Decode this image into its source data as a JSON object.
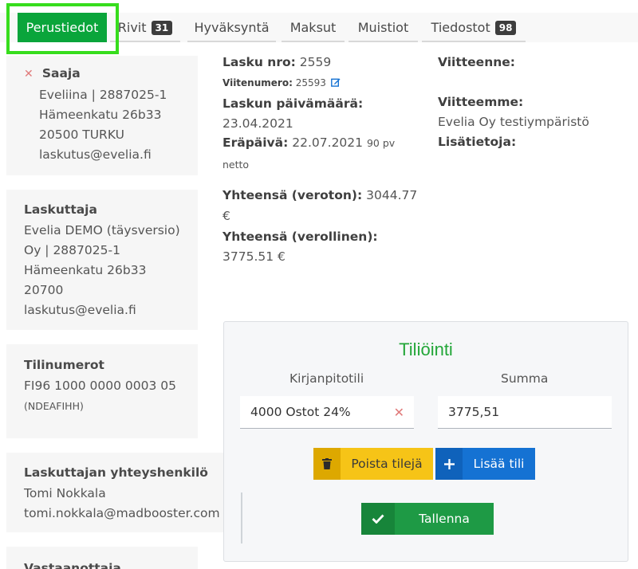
{
  "tabs": [
    {
      "label": "Perustiedot",
      "badge": null
    },
    {
      "label": "Rivit",
      "badge": "31"
    },
    {
      "label": "Hyväksyntä",
      "badge": null
    },
    {
      "label": "Maksut",
      "badge": null
    },
    {
      "label": "Muistiot",
      "badge": null
    },
    {
      "label": "Tiedostot",
      "badge": "98"
    }
  ],
  "recipient": {
    "title": "Saaja",
    "remove_symbol": "✕",
    "lines": [
      "Eveliina | 2887025-1",
      "Hämeenkatu 26b33",
      "20500 TURKU",
      "laskutus@evelia.fi"
    ]
  },
  "biller": {
    "title": "Laskuttaja",
    "lines": [
      "Evelia DEMO (täysversio)",
      "Oy | 2887025-1",
      "Hämeenkatu 26b33",
      "20700",
      "laskutus@evelia.fi"
    ]
  },
  "accounts": {
    "title": "Tilinumerot",
    "iban": "FI96 1000 0000 0003 05",
    "bic": "(NDEAFIHH)"
  },
  "contact": {
    "title": "Laskuttajan yhteyshenkilö",
    "name": "Tomi Nokkala",
    "email": "tomi.nokkala@madbooster.com"
  },
  "receiver": {
    "title": "Vastaanottaja"
  },
  "invoice": {
    "number_label": "Lasku nro:",
    "number": "2559",
    "reference_label": "Viitenumero:",
    "reference": "25593",
    "date_label": "Laskun päivämäärä:",
    "date": "23.04.2021",
    "due_label": "Eräpäivä:",
    "due": "22.07.2021",
    "terms_days": "90 pv",
    "terms_net": "netto",
    "total_excl_label": "Yhteensä (veroton):",
    "total_excl": "3044.77",
    "total_excl_currency": "€",
    "total_incl_label": "Yhteensä (verollinen):",
    "total_incl": "3775.51 €"
  },
  "references": {
    "your_ref_label": "Viitteenne:",
    "your_ref": "",
    "our_ref_label": "Viitteemme:",
    "our_ref": "Evelia Oy testiympäristö",
    "extra_label": "Lisätietoja:"
  },
  "accounting": {
    "title": "Tiliöinti",
    "col_account": "Kirjanpitotili",
    "col_sum": "Summa",
    "account_value": "4000 Ostot 24%",
    "sum_value": "3775,51",
    "remove_accounts": "Poista tilejä",
    "add_account": "Lisää tili",
    "save": "Tallenna"
  },
  "colors": {
    "active_tab": "#0aa53b",
    "focus_ring": "#37dd1d",
    "title_green": "#22a638",
    "btn_remove": "#f6c417",
    "btn_add": "#1572d3",
    "btn_save": "#1e9a45"
  },
  "icons": {
    "edit": "edit-icon",
    "trash": "trash-icon",
    "plus": "plus-icon",
    "check": "check-icon",
    "remove": "x-icon"
  }
}
